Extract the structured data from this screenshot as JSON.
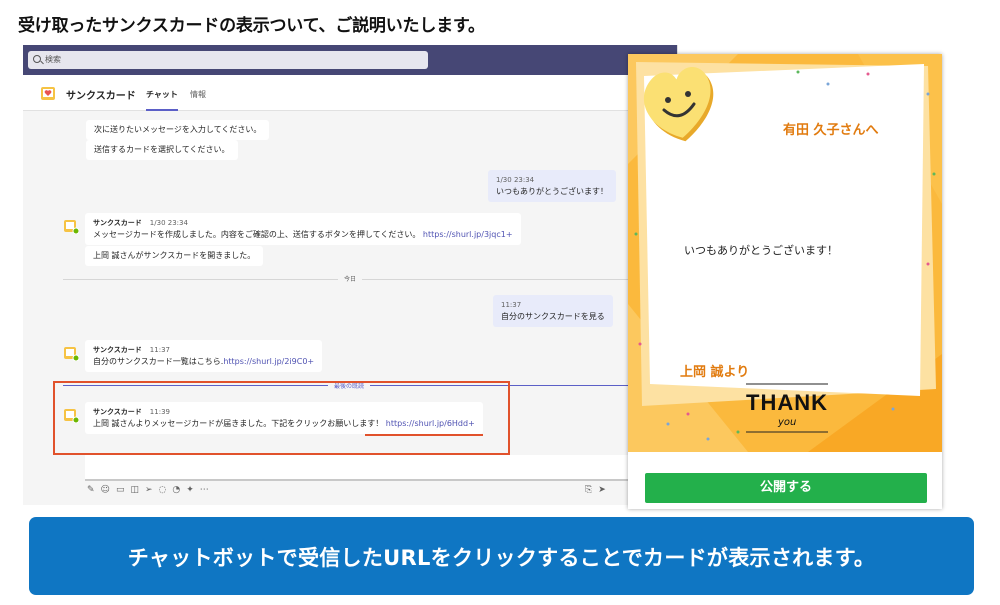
{
  "heading": "受け取ったサンクスカードの表示ついて、ご説明いたします。",
  "teams": {
    "search_placeholder": "検索",
    "app_name": "サンクスカード",
    "tabs": [
      "チャット",
      "情報"
    ],
    "messages": {
      "bot_line_1": "次に送りたいメッセージを入力してください。",
      "bot_line_2": "送信するカードを選択してください。",
      "mine_1_time": "1/30 23:34",
      "mine_1_text": "いつもありがとうございます！",
      "bot_1_sender": "サンクスカード",
      "bot_1_time": "1/30 23:34",
      "bot_1_text": "メッセージカードを作成しました。内容をご確認の上、送信するボタンを押してください。",
      "bot_1_link": "https://shurl.jp/3jqc1+",
      "bot_1_followup": "上岡 誠さんがサンクスカードを開きました。",
      "divider_today": "今日",
      "mine_2_time": "11:37",
      "mine_2_text": "自分のサンクスカードを見る",
      "bot_2_sender": "サンクスカード",
      "bot_2_time": "11:37",
      "bot_2_text": "自分のサンクスカード一覧はこちら.",
      "bot_2_link": "https://shurl.jp/2i9C0+",
      "divider_last_read": "最後の既読",
      "bot_3_sender": "サンクスカード",
      "bot_3_time": "11:39",
      "bot_3_text": "上岡 誠さんよりメッセージカードが届きました。下記をクリックお願いします！",
      "bot_3_link": "https://shurl.jp/6Hdd+"
    },
    "toolbar_icons": [
      "format-icon",
      "emoji-icon",
      "gif-icon",
      "sticker-icon",
      "send-later-icon",
      "stream-icon",
      "loop-icon",
      "praise-icon",
      "more-icon"
    ]
  },
  "card": {
    "recipient": "有田 久子さんへ",
    "message": "いつもありがとうございます！",
    "sender": "上岡 誠より",
    "thank": "THANK",
    "you": "you",
    "publish_button": "公開する"
  },
  "banner": "チャットボットで受信したURLをクリックすることでカードが表示されます。",
  "colors": {
    "teams_header": "#464775",
    "teams_accent": "#5b5fc7",
    "highlight": "#e1522c",
    "card_orange": "#e17b0f",
    "publish_green": "#23b04b",
    "banner_blue": "#0f76c3"
  }
}
